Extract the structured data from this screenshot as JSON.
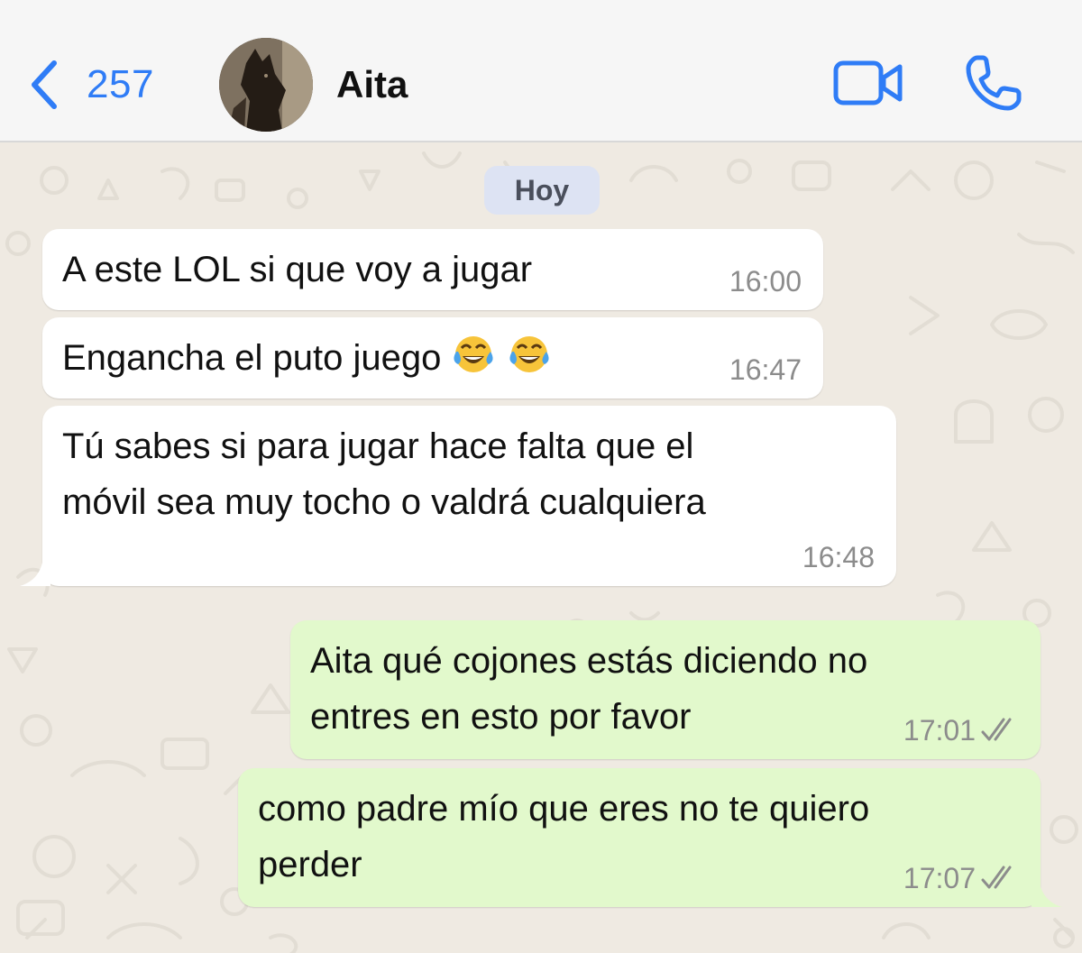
{
  "header": {
    "back_count": "257",
    "contact_name": "Aita",
    "icons": {
      "back": "chevron-left-icon",
      "video": "video-camera-icon",
      "call": "phone-icon"
    },
    "accent_color": "#2f7cf6"
  },
  "chat": {
    "date_chip": "Hoy",
    "messages": [
      {
        "direction": "incoming",
        "lines": [
          "A este LOL si que voy a jugar"
        ],
        "time": "16:00"
      },
      {
        "direction": "incoming",
        "text": "Engancha el puto juego",
        "emoji": [
          "face-with-tears-of-joy",
          "face-with-tears-of-joy"
        ],
        "time": "16:47"
      },
      {
        "direction": "incoming",
        "lines": [
          "Tú sabes si para jugar hace falta que el",
          "móvil sea muy tocho o valdrá cualquiera"
        ],
        "time": "16:48"
      },
      {
        "direction": "outgoing",
        "lines": [
          "Aita qué cojones estás diciendo no",
          "entres en esto por favor"
        ],
        "time": "17:01",
        "status": "read-double-check"
      },
      {
        "direction": "outgoing",
        "lines": [
          "como padre mío que eres no te quiero",
          "perder"
        ],
        "time": "17:07",
        "status": "read-double-check"
      }
    ],
    "colors": {
      "incoming_bubble": "#ffffff",
      "outgoing_bubble": "#e2f9cc",
      "background": "#efeae2"
    }
  }
}
